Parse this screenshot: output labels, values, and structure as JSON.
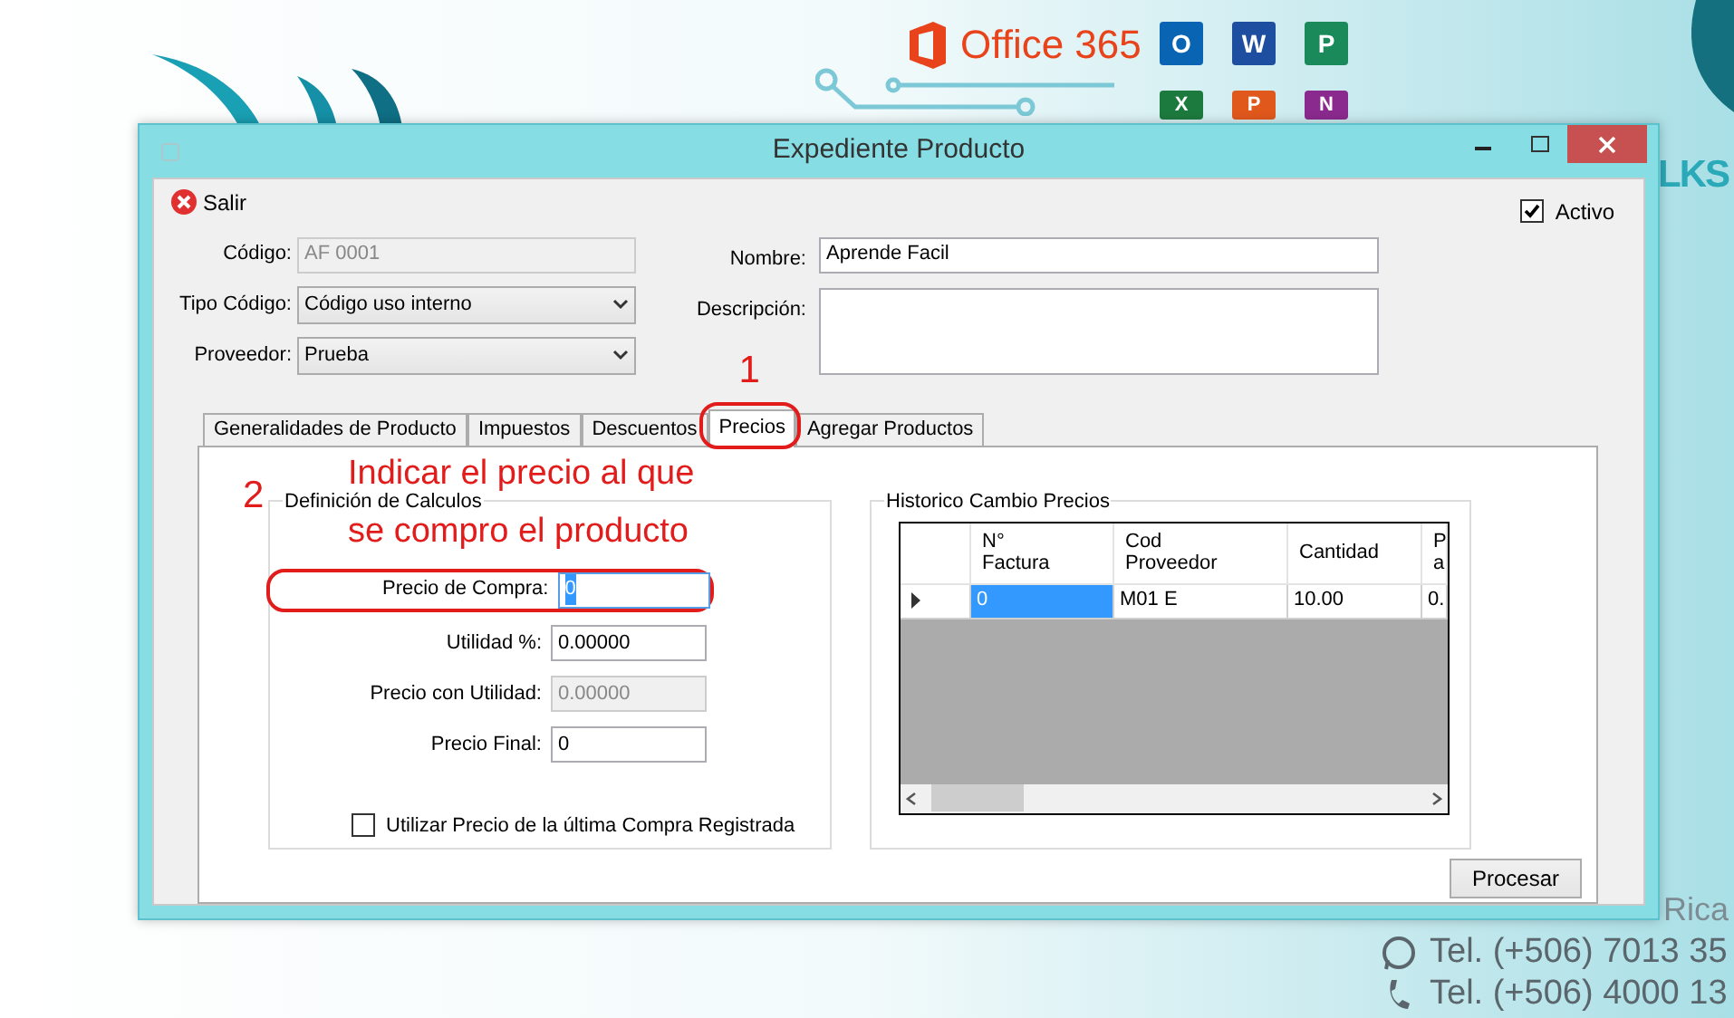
{
  "desktop": {
    "logo_text": "Office 365",
    "brand_text": "LKS",
    "address_text": "Rica",
    "phones": [
      "Tel. (+506) 7013 35",
      "Tel. (+506) 4000 13"
    ]
  },
  "app_icons": [
    {
      "letter": "O",
      "color": "#0a64b4"
    },
    {
      "letter": "W",
      "color": "#1e4ea0"
    },
    {
      "letter": "P",
      "color": "#1a8a5a"
    },
    {
      "letter": "X",
      "color": "#1d7a3e"
    },
    {
      "letter": "P",
      "color": "#e0581c"
    },
    {
      "letter": "N",
      "color": "#8a2a8e"
    }
  ],
  "window": {
    "title": "Expediente Producto"
  },
  "toolbar": {
    "exit_label": "Salir"
  },
  "active": {
    "label": "Activo",
    "checked": true
  },
  "form_left": [
    {
      "label": "Código:",
      "value": "AF 0001",
      "kind": "readonly"
    },
    {
      "label": "Tipo Código:",
      "value": "Código uso interno",
      "kind": "select"
    },
    {
      "label": "Proveedor:",
      "value": "Prueba",
      "kind": "select"
    }
  ],
  "form_right": [
    {
      "label": "Nombre:",
      "value": "Aprende Facil",
      "kind": "text"
    },
    {
      "label": "Descripción:",
      "kind": "textarea"
    }
  ],
  "tabs": [
    {
      "label": "Generalidades de Producto",
      "selected": false
    },
    {
      "label": "Impuestos",
      "selected": false
    },
    {
      "label": "Descuentos",
      "selected": false
    },
    {
      "label": "Precios",
      "selected": true
    },
    {
      "label": "Agregar Productos",
      "selected": false
    }
  ],
  "calc_group": {
    "title": "Definición de Calculos",
    "fields": [
      {
        "label": "Precio de Compra:",
        "value": "0",
        "kind": "focused"
      },
      {
        "label": "Utilidad %:",
        "value": "0.00000",
        "kind": "text"
      },
      {
        "label": "Precio con Utilidad:",
        "value": "0.00000",
        "kind": "readonly"
      },
      {
        "label": "Precio Final:",
        "value": "0",
        "kind": "text"
      }
    ],
    "checkbox": {
      "label": "Utilizar Precio de la última Compra Registrada",
      "checked": false
    }
  },
  "history_group": {
    "title": "Historico Cambio Precios",
    "columns": [
      "N°\nFactura",
      "Cod\nProveedor",
      "Cantidad",
      "P\na"
    ],
    "rows": [
      {
        "selected": true,
        "cells": [
          {
            "text": "0",
            "selected": true
          },
          {
            "text": "M01 E",
            "selected": false
          },
          {
            "text": "10.00",
            "selected": false
          },
          {
            "text": "0.",
            "selected": false
          }
        ]
      }
    ]
  },
  "annotations": {
    "tab_marker": "1",
    "field_marker": "2",
    "note_lines": [
      "Indicar el precio al que",
      "se compro el producto"
    ]
  },
  "buttons": [
    "Procesar"
  ]
}
